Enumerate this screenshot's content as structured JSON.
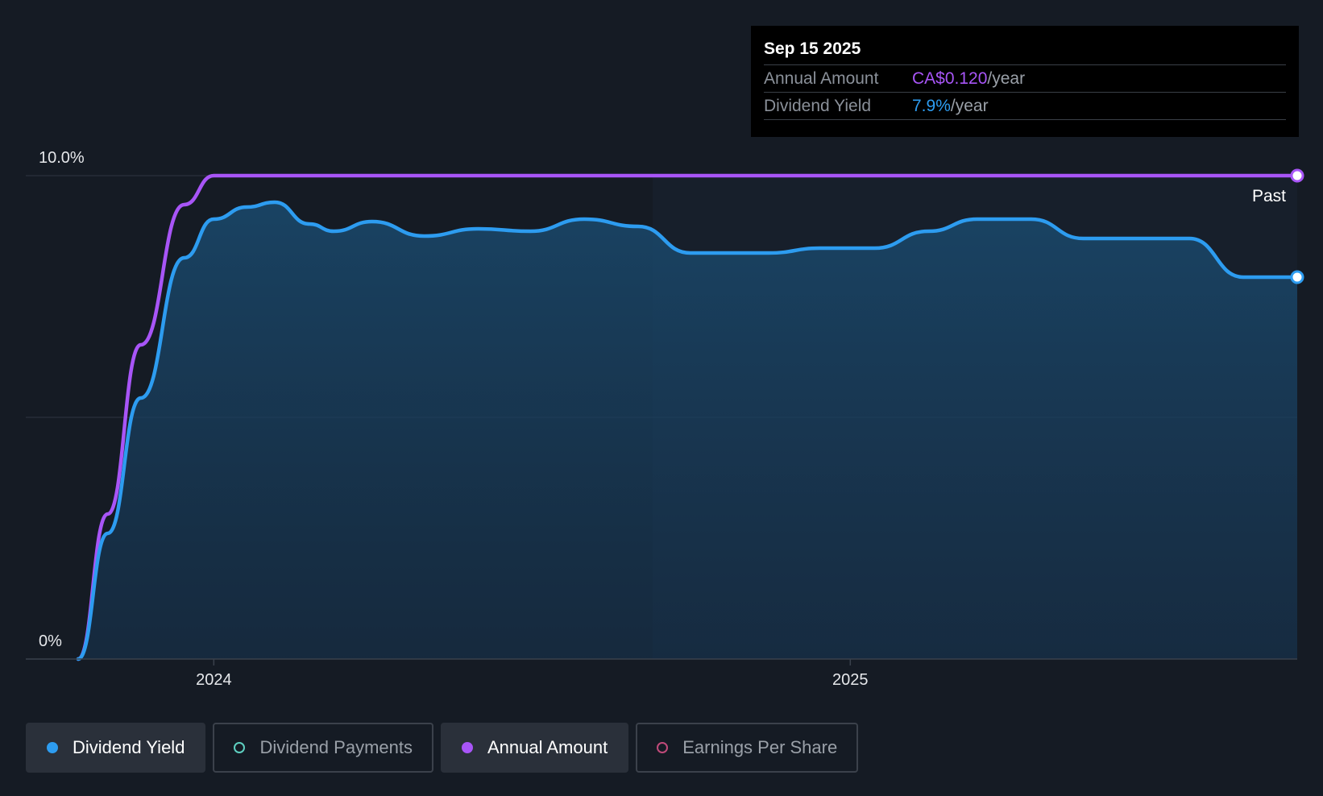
{
  "chart_data": {
    "type": "line",
    "x_axis": {
      "type": "date",
      "ticks": [
        "2024",
        "2025"
      ],
      "range": [
        "2023-10-15",
        "2025-09-15"
      ]
    },
    "y_axis": {
      "tick_labels": [
        "10.0%",
        "0%"
      ],
      "range": [
        0,
        10
      ],
      "unit": "%"
    },
    "grid": true,
    "past_label": "Past",
    "series": [
      {
        "name": "Annual Amount",
        "color": "#a855f7",
        "points": [
          [
            "2023-10-15",
            0
          ],
          [
            "2023-11-01",
            3.0
          ],
          [
            "2023-11-20",
            6.5
          ],
          [
            "2023-12-15",
            9.4
          ],
          [
            "2024-01-01",
            10.0
          ],
          [
            "2025-09-15",
            10.0
          ]
        ]
      },
      {
        "name": "Dividend Yield",
        "color": "#2d9cf0",
        "fill": true,
        "points": [
          [
            "2023-10-15",
            0
          ],
          [
            "2023-11-01",
            2.6
          ],
          [
            "2023-11-20",
            5.4
          ],
          [
            "2023-12-15",
            8.3
          ],
          [
            "2024-01-01",
            9.1
          ],
          [
            "2024-01-20",
            9.35
          ],
          [
            "2024-02-05",
            9.45
          ],
          [
            "2024-02-25",
            9.0
          ],
          [
            "2024-03-10",
            8.85
          ],
          [
            "2024-04-01",
            9.05
          ],
          [
            "2024-05-01",
            8.75
          ],
          [
            "2024-06-01",
            8.9
          ],
          [
            "2024-07-01",
            8.85
          ],
          [
            "2024-08-01",
            9.1
          ],
          [
            "2024-09-01",
            8.95
          ],
          [
            "2024-10-01",
            8.4
          ],
          [
            "2024-11-15",
            8.4
          ],
          [
            "2024-12-15",
            8.5
          ],
          [
            "2025-01-15",
            8.5
          ],
          [
            "2025-02-15",
            8.85
          ],
          [
            "2025-03-15",
            9.1
          ],
          [
            "2025-04-15",
            9.1
          ],
          [
            "2025-05-15",
            8.7
          ],
          [
            "2025-06-15",
            8.7
          ],
          [
            "2025-07-15",
            8.7
          ],
          [
            "2025-08-15",
            7.9
          ],
          [
            "2025-09-15",
            7.9
          ]
        ]
      }
    ]
  },
  "tooltip": {
    "date": "Sep 15 2025",
    "rows": [
      {
        "label": "Annual Amount",
        "value": "CA$0.120",
        "unit": "/year"
      },
      {
        "label": "Dividend Yield",
        "value": "7.9%",
        "unit": "/year"
      }
    ]
  },
  "legend": [
    {
      "label": "Dividend Yield",
      "active": true,
      "color": "#2d9cf0"
    },
    {
      "label": "Dividend Payments",
      "active": false,
      "color": "#5ecfc0"
    },
    {
      "label": "Annual Amount",
      "active": true,
      "color": "#a855f7"
    },
    {
      "label": "Earnings Per Share",
      "active": false,
      "color": "#c04a7a"
    }
  ]
}
